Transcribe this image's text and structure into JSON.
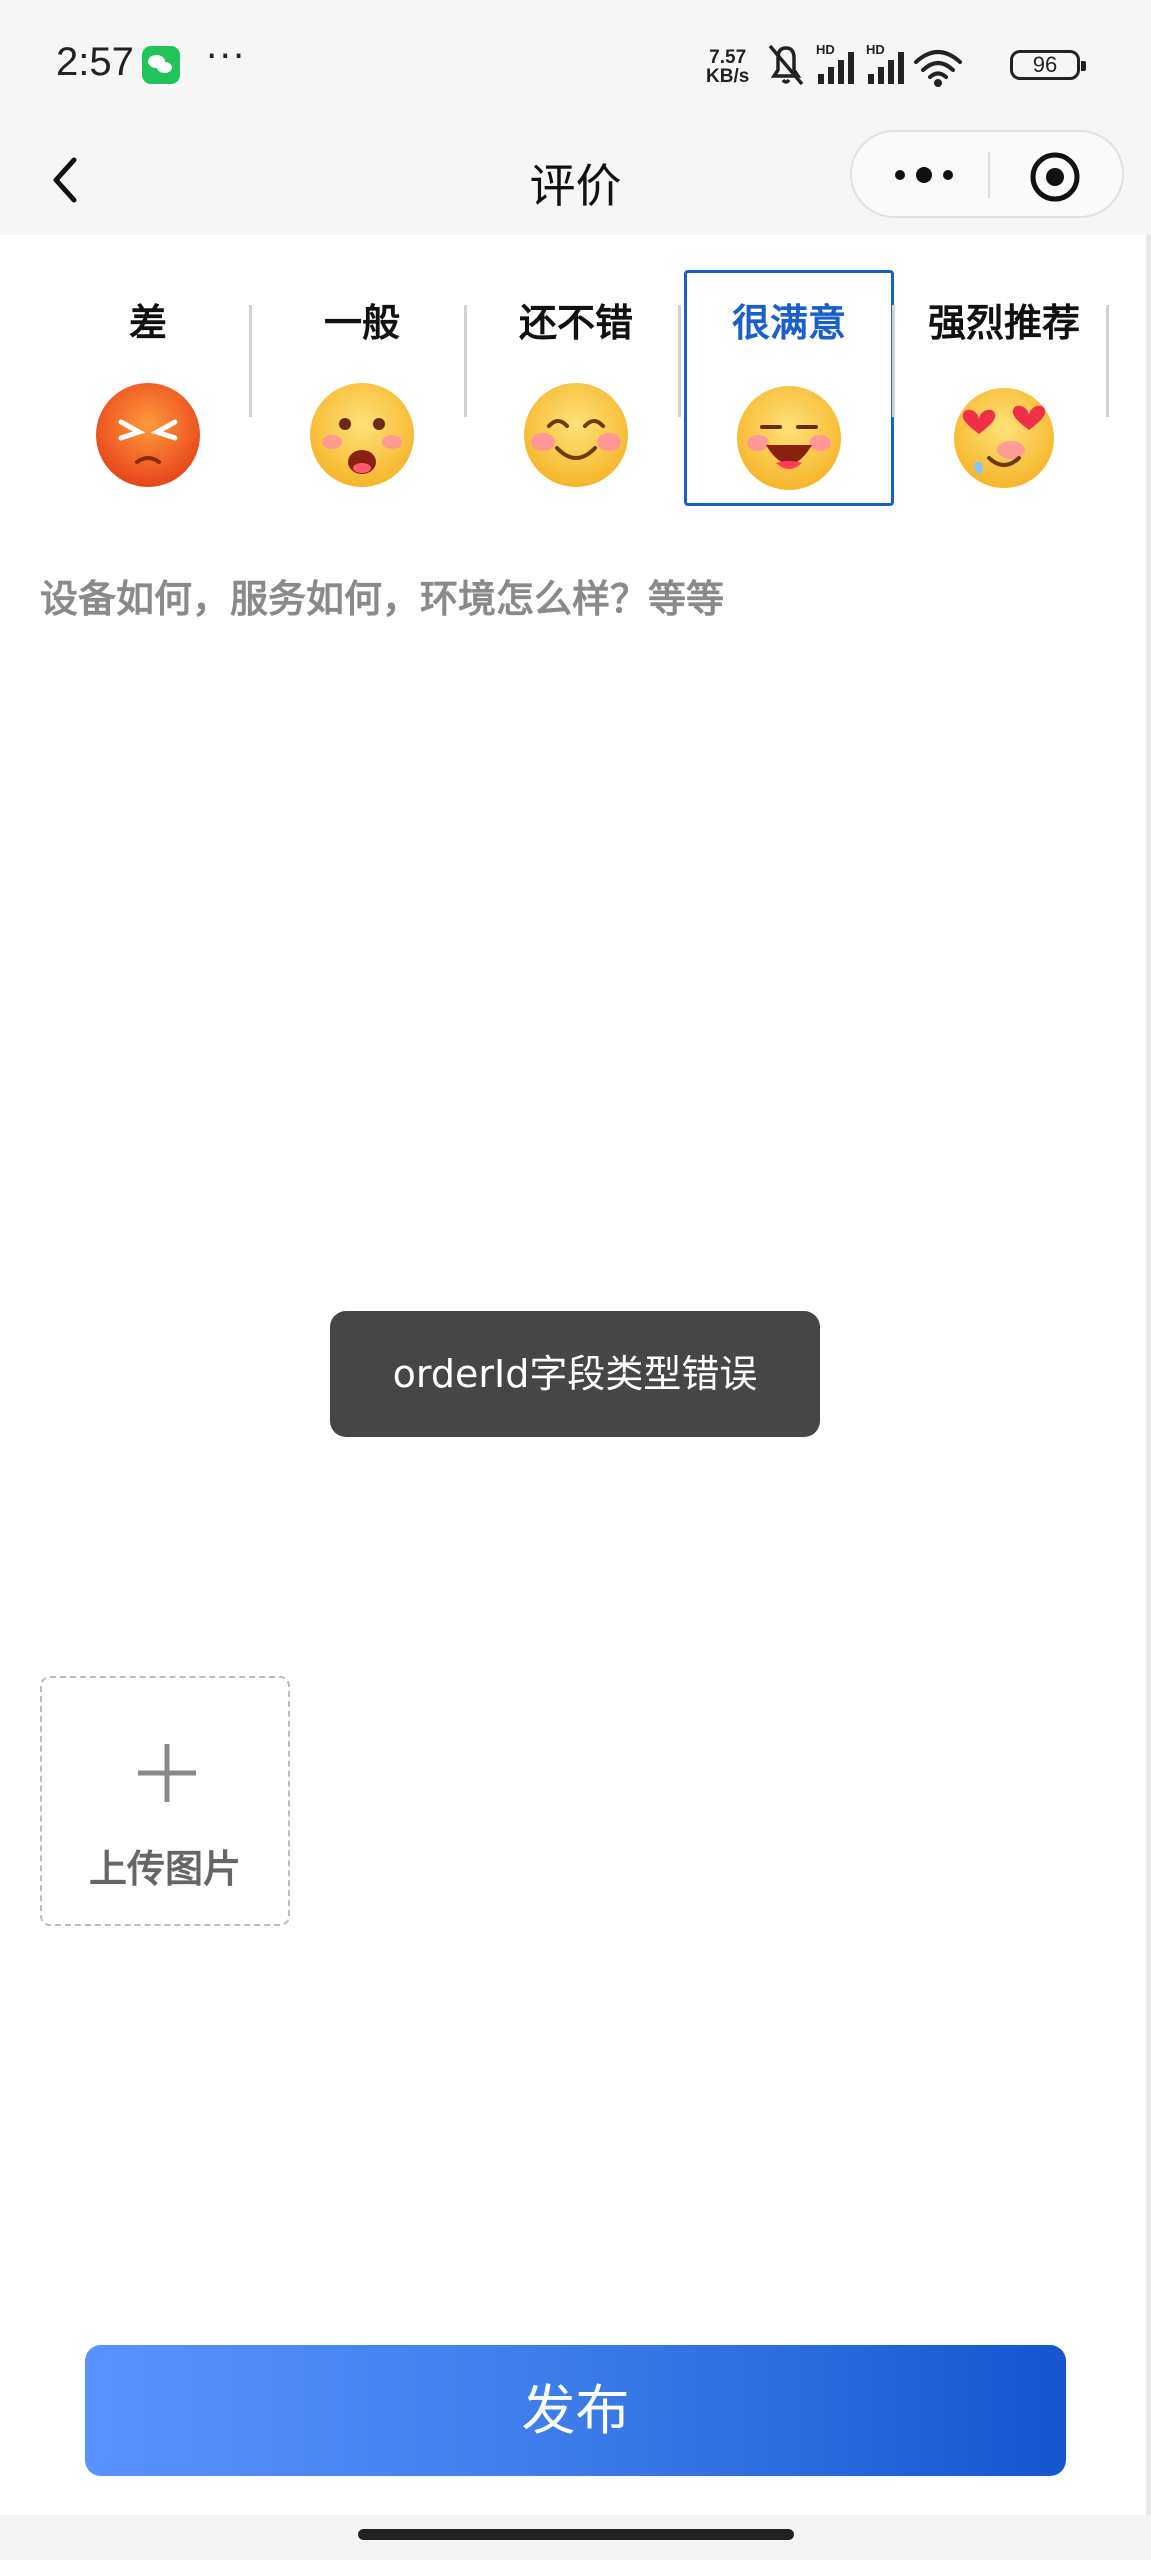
{
  "status_bar": {
    "time": "2:57",
    "more": "···",
    "net_speed_value": "7.57",
    "net_speed_unit": "KB/s",
    "battery": "96"
  },
  "nav": {
    "title": "评价"
  },
  "rating": {
    "options": [
      {
        "label": "差",
        "face": "angry-face-icon"
      },
      {
        "label": "一般",
        "face": "shocked-face-icon"
      },
      {
        "label": "还不错",
        "face": "smiling-face-icon"
      },
      {
        "label": "很满意",
        "face": "grinning-face-icon"
      },
      {
        "label": "强烈推荐",
        "face": "heart-eyes-face-icon"
      }
    ],
    "selected_index": 3,
    "selected_color": "#1b5fc9"
  },
  "comment": {
    "placeholder": "设备如何，服务如何，环境怎么样？等等"
  },
  "toast": {
    "message": "orderId字段类型错误"
  },
  "upload": {
    "label": "上传图片"
  },
  "publish": {
    "label": "发布"
  }
}
